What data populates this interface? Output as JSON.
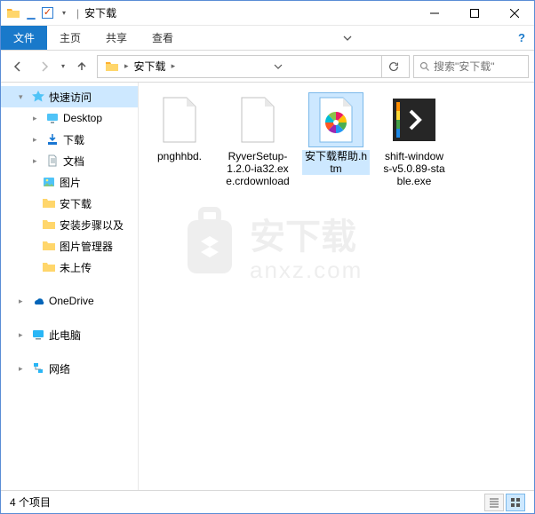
{
  "window": {
    "title": "安下载"
  },
  "ribbon": {
    "file": "文件",
    "tabs": [
      "主页",
      "共享",
      "查看"
    ]
  },
  "breadcrumb": {
    "segments": [
      "安下载"
    ]
  },
  "search": {
    "placeholder": "搜索\"安下载\""
  },
  "sidebar": {
    "quick_access": "快速访问",
    "items": [
      {
        "label": "Desktop",
        "icon": "desktop"
      },
      {
        "label": "下载",
        "icon": "downloads"
      },
      {
        "label": "文档",
        "icon": "documents"
      },
      {
        "label": "图片",
        "icon": "pictures"
      },
      {
        "label": "安下载",
        "icon": "folder"
      },
      {
        "label": "安装步骤以及",
        "icon": "folder"
      },
      {
        "label": "图片管理器",
        "icon": "folder"
      },
      {
        "label": "未上传",
        "icon": "folder"
      }
    ],
    "onedrive": "OneDrive",
    "this_pc": "此电脑",
    "network": "网络"
  },
  "files": [
    {
      "name": "pnghhbd.",
      "type": "blank"
    },
    {
      "name": "RyverSetup-1.2.0-ia32.exe.crdownload",
      "type": "blank"
    },
    {
      "name": "安下载帮助.htm",
      "type": "htm",
      "selected": true
    },
    {
      "name": "shift-windows-v5.0.89-stable.exe",
      "type": "exe"
    }
  ],
  "status": {
    "count_text": "4 个项目"
  },
  "watermark": {
    "text1": "安下载",
    "text2": "anxz.com"
  }
}
